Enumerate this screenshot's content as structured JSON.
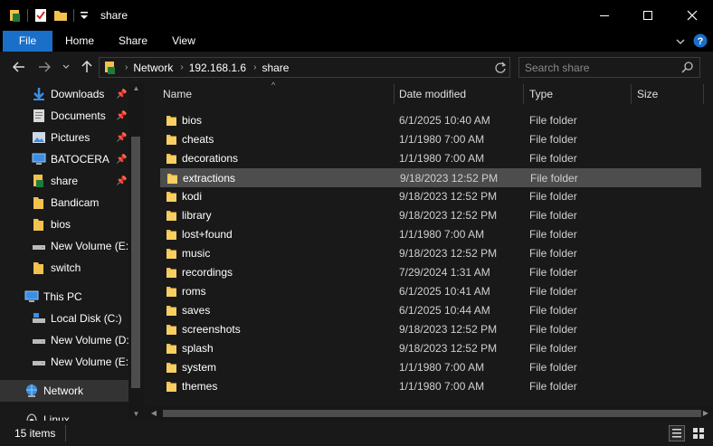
{
  "window": {
    "title": "share",
    "minimize_icon": "minimize-icon",
    "maximize_icon": "maximize-icon",
    "close_icon": "close-icon"
  },
  "ribbon": {
    "tabs": [
      "File",
      "Home",
      "Share",
      "View"
    ],
    "accent": "#1a6fc9"
  },
  "nav": {
    "crumbs": [
      "Network",
      "192.168.1.6",
      "share"
    ],
    "search_placeholder": "Search share"
  },
  "sidebar": {
    "items": [
      {
        "label": "Downloads",
        "icon": "download-arrow-icon",
        "pinned": true
      },
      {
        "label": "Documents",
        "icon": "documents-icon",
        "pinned": true
      },
      {
        "label": "Pictures",
        "icon": "pictures-icon",
        "pinned": true
      },
      {
        "label": "BATOCERA",
        "icon": "monitor-icon",
        "pinned": true
      },
      {
        "label": "share",
        "icon": "folder-icon",
        "pinned": true
      },
      {
        "label": "Bandicam",
        "icon": "folder-icon",
        "pinned": false
      },
      {
        "label": "bios",
        "icon": "folder-icon",
        "pinned": false
      },
      {
        "label": "New Volume (E:)",
        "icon": "drive-icon",
        "pinned": false
      },
      {
        "label": "switch",
        "icon": "folder-icon",
        "pinned": false
      },
      {
        "label": "This PC",
        "icon": "this-pc-icon",
        "pinned": false
      },
      {
        "label": "Local Disk (C:)",
        "icon": "system-drive-icon",
        "pinned": false
      },
      {
        "label": "New Volume (D:)",
        "icon": "drive-icon",
        "pinned": false
      },
      {
        "label": "New Volume (E:)",
        "icon": "drive-icon",
        "pinned": false
      },
      {
        "label": "Network",
        "icon": "network-icon",
        "pinned": false
      },
      {
        "label": "Linux",
        "icon": "linux-icon",
        "pinned": false
      }
    ]
  },
  "columns": [
    "Name",
    "Date modified",
    "Type",
    "Size"
  ],
  "files": [
    {
      "name": "bios",
      "date": "6/1/2025 10:40 AM",
      "type": "File folder"
    },
    {
      "name": "cheats",
      "date": "1/1/1980 7:00 AM",
      "type": "File folder"
    },
    {
      "name": "decorations",
      "date": "1/1/1980 7:00 AM",
      "type": "File folder"
    },
    {
      "name": "extractions",
      "date": "9/18/2023 12:52 PM",
      "type": "File folder"
    },
    {
      "name": "kodi",
      "date": "9/18/2023 12:52 PM",
      "type": "File folder"
    },
    {
      "name": "library",
      "date": "9/18/2023 12:52 PM",
      "type": "File folder"
    },
    {
      "name": "lost+found",
      "date": "1/1/1980 7:00 AM",
      "type": "File folder"
    },
    {
      "name": "music",
      "date": "9/18/2023 12:52 PM",
      "type": "File folder"
    },
    {
      "name": "recordings",
      "date": "7/29/2024 1:31 AM",
      "type": "File folder"
    },
    {
      "name": "roms",
      "date": "6/1/2025 10:41 AM",
      "type": "File folder"
    },
    {
      "name": "saves",
      "date": "6/1/2025 10:44 AM",
      "type": "File folder"
    },
    {
      "name": "screenshots",
      "date": "9/18/2023 12:52 PM",
      "type": "File folder"
    },
    {
      "name": "splash",
      "date": "9/18/2023 12:52 PM",
      "type": "File folder"
    },
    {
      "name": "system",
      "date": "1/1/1980 7:00 AM",
      "type": "File folder"
    },
    {
      "name": "themes",
      "date": "1/1/1980 7:00 AM",
      "type": "File folder"
    }
  ],
  "status": {
    "count": "15 items"
  },
  "colors": {
    "folder": "#f2c14e",
    "selection": "#4d4d4d",
    "background": "#191919"
  }
}
